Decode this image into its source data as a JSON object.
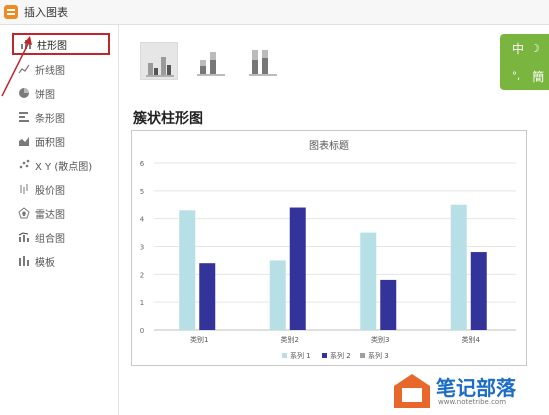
{
  "window": {
    "title": "插入图表"
  },
  "sidebar": {
    "items": [
      {
        "label": "柱形图",
        "icon": "bar-chart-icon",
        "active": true
      },
      {
        "label": "折线图",
        "icon": "line-chart-icon"
      },
      {
        "label": "饼图",
        "icon": "pie-chart-icon"
      },
      {
        "label": "条形图",
        "icon": "horizontal-bar-icon"
      },
      {
        "label": "面积图",
        "icon": "area-chart-icon"
      },
      {
        "label": "X Y (散点图)",
        "icon": "scatter-chart-icon"
      },
      {
        "label": "股价图",
        "icon": "stock-chart-icon"
      },
      {
        "label": "雷达图",
        "icon": "radar-chart-icon"
      },
      {
        "label": "组合图",
        "icon": "combo-chart-icon"
      },
      {
        "label": "模板",
        "icon": "template-icon"
      }
    ]
  },
  "subtypes": {
    "items": [
      {
        "name": "clustered-column",
        "selected": true
      },
      {
        "name": "stacked-column"
      },
      {
        "name": "percent-stacked-column"
      }
    ]
  },
  "main": {
    "subtitle": "簇状柱形图"
  },
  "lang": {
    "zh_label": "中",
    "simp_label": "簡"
  },
  "watermark": {
    "text": "笔记部落",
    "url": "www.notetribe.com"
  },
  "colors": {
    "series1": "#b7dfe6",
    "series2": "#333399",
    "series3": "#9aa0a6",
    "highlight": "#c0272d",
    "lang_bg": "#79b53f"
  },
  "chart_data": {
    "type": "bar",
    "title": "图表标题",
    "categories": [
      "类别1",
      "类别2",
      "类别3",
      "类别4"
    ],
    "series": [
      {
        "name": "系列 1",
        "values": [
          4.3,
          2.5,
          3.5,
          4.5
        ]
      },
      {
        "name": "系列 2",
        "values": [
          2.4,
          4.4,
          1.8,
          2.8
        ]
      },
      {
        "name": "系列 3",
        "values": [
          0,
          0,
          0,
          0
        ]
      }
    ],
    "ylim": [
      0,
      6
    ],
    "yticks": [
      0,
      1,
      2,
      3,
      4,
      5,
      6
    ],
    "grid": true,
    "legend": "bottom"
  }
}
